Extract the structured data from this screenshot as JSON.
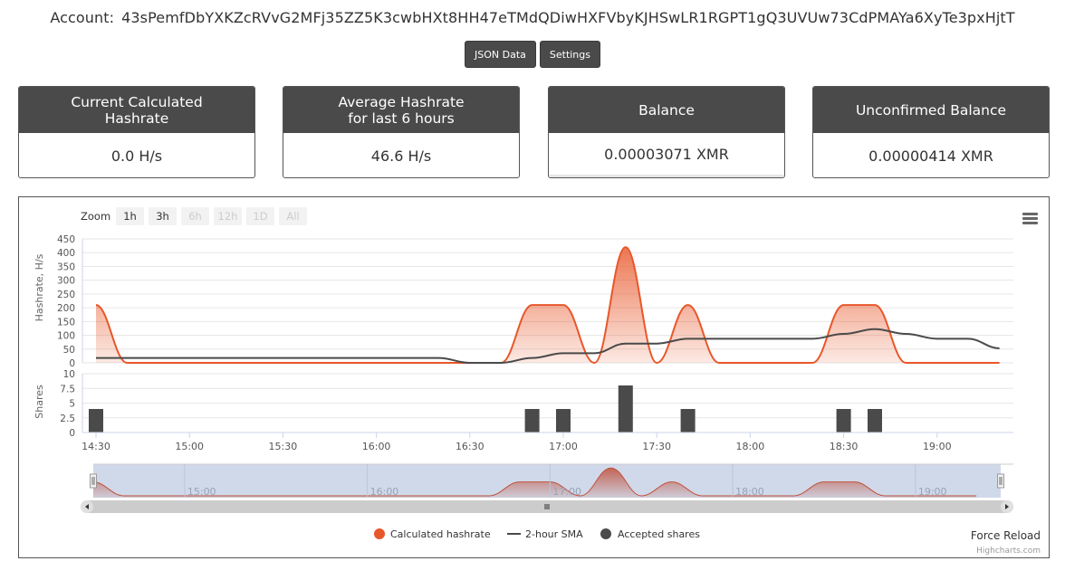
{
  "header": {
    "account_label": "Account:",
    "account_address": "43sPemfDbYXKZcRVvG2MFj35ZZ5K3cwbHXt8HH47eTMdQDiwHXFVbyKJHSwLR1RGPT1gQ3UVUw73CdPMAYa6XyTe3pxHjtT"
  },
  "buttons": {
    "json_data": "JSON Data",
    "settings": "Settings"
  },
  "cards": [
    {
      "title": "Current Calculated Hashrate",
      "title_lines": [
        "Current Calculated",
        "Hashrate"
      ],
      "value": "0.0 H/s"
    },
    {
      "title": "Average Hashrate for last 6 hours",
      "title_lines": [
        "Average Hashrate",
        "for last 6 hours"
      ],
      "value": "46.6 H/s"
    },
    {
      "title": "Balance",
      "title_lines": [
        "Balance"
      ],
      "value": "0.00003071 XMR"
    },
    {
      "title": "Unconfirmed Balance",
      "title_lines": [
        "Unconfirmed Balance"
      ],
      "value": "0.00000414 XMR"
    }
  ],
  "chart": {
    "zoom_label": "Zoom",
    "zoom_buttons": [
      {
        "label": "1h",
        "enabled": true
      },
      {
        "label": "3h",
        "enabled": true,
        "selected": true
      },
      {
        "label": "6h",
        "enabled": false
      },
      {
        "label": "12h",
        "enabled": false
      },
      {
        "label": "1D",
        "enabled": false
      },
      {
        "label": "All",
        "enabled": false
      }
    ],
    "menu_icon": "hamburger-menu-icon",
    "force_reload": "Force Reload",
    "credits": "Highcharts.com",
    "colors": {
      "hashrate": "#e8572a",
      "sma": "#4a4a4a",
      "shares": "#4a4a4a",
      "navigator_mask": "#d0d9ea",
      "grid": "#e6e6e6"
    }
  },
  "chart_data": {
    "type": "area",
    "title": "",
    "x_ticks": [
      "14:30",
      "15:00",
      "15:30",
      "16:00",
      "16:30",
      "17:00",
      "17:30",
      "18:00",
      "18:30",
      "19:00"
    ],
    "x_range": [
      "14:30",
      "19:20"
    ],
    "navigator_ticks": [
      "15:00",
      "16:00",
      "17:00",
      "18:00",
      "19:00"
    ],
    "panels": [
      {
        "name": "hashrate",
        "ylabel": "Hashrate, H/s",
        "ylim": [
          0,
          450
        ],
        "yticks": [
          0,
          50,
          100,
          150,
          200,
          250,
          300,
          350,
          400,
          450
        ],
        "grid": true
      },
      {
        "name": "shares",
        "ylabel": "Shares",
        "ylim": [
          0,
          10
        ],
        "yticks": [
          0,
          2.5,
          5,
          7.5,
          10
        ],
        "grid": true
      }
    ],
    "x": [
      "14:30",
      "14:40",
      "14:50",
      "15:00",
      "15:10",
      "15:20",
      "15:30",
      "15:40",
      "15:50",
      "16:00",
      "16:10",
      "16:20",
      "16:30",
      "16:40",
      "16:50",
      "17:00",
      "17:10",
      "17:20",
      "17:30",
      "17:40",
      "17:50",
      "18:00",
      "18:10",
      "18:20",
      "18:30",
      "18:40",
      "18:50",
      "19:00",
      "19:10",
      "19:20"
    ],
    "series": [
      {
        "name": "Calculated hashrate",
        "type": "areaspline",
        "panel": "hashrate",
        "values": [
          210,
          0,
          0,
          0,
          0,
          0,
          0,
          0,
          0,
          0,
          0,
          0,
          0,
          0,
          210,
          210,
          0,
          420,
          0,
          210,
          0,
          0,
          0,
          0,
          210,
          210,
          0,
          0,
          0,
          0
        ]
      },
      {
        "name": "2-hour SMA",
        "type": "spline",
        "panel": "hashrate",
        "values": [
          17.5,
          17.5,
          17.5,
          17.5,
          17.5,
          17.5,
          17.5,
          17.5,
          17.5,
          17.5,
          17.5,
          17.5,
          0,
          0,
          17.5,
          35,
          35,
          70,
          70,
          87.5,
          87.5,
          87.5,
          87.5,
          87.5,
          105,
          122.5,
          105,
          87.5,
          87.5,
          52.5
        ]
      },
      {
        "name": "Accepted shares",
        "type": "column",
        "panel": "shares",
        "values": [
          4,
          0,
          0,
          0,
          0,
          0,
          0,
          0,
          0,
          0,
          0,
          0,
          0,
          0,
          4,
          4,
          0,
          8,
          0,
          4,
          0,
          0,
          0,
          0,
          4,
          4,
          0,
          0,
          0,
          0
        ]
      }
    ],
    "legend": {
      "placement": "bottom-center",
      "items": [
        "Calculated hashrate",
        "2-hour SMA",
        "Accepted shares"
      ]
    }
  }
}
